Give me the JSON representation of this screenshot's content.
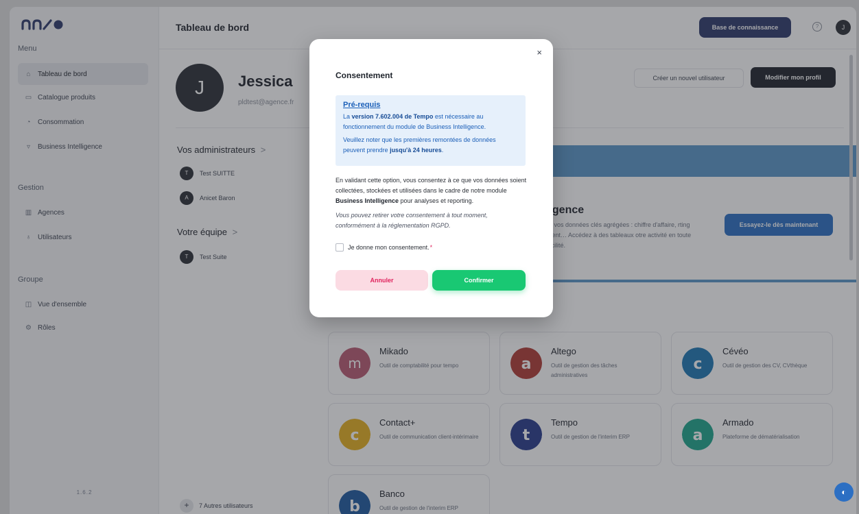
{
  "sidebar": {
    "logo": "enso",
    "sections": [
      {
        "title": "Menu",
        "items": [
          {
            "label": "Tableau de bord",
            "icon": "home-icon",
            "active": true
          },
          {
            "label": "Catalogue produits",
            "icon": "catalog-icon"
          },
          {
            "label": "Consommation",
            "icon": "chart-icon"
          },
          {
            "label": "Business Intelligence",
            "icon": "bi-icon"
          }
        ]
      },
      {
        "title": "Gestion",
        "items": [
          {
            "label": "Agences",
            "icon": "building-icon"
          },
          {
            "label": "Utilisateurs",
            "icon": "users-icon"
          }
        ]
      },
      {
        "title": "Groupe",
        "items": [
          {
            "label": "Vue d'ensemble",
            "icon": "overview-icon"
          },
          {
            "label": "Rôles",
            "icon": "roles-icon"
          }
        ]
      }
    ],
    "version": "1.6.2"
  },
  "header": {
    "title": "Tableau de bord",
    "knowledge_base_button": "Base de connaissance",
    "help_icon": "?",
    "avatar_initial": "J"
  },
  "profile": {
    "initial": "J",
    "name": "Jessica",
    "email": "pldtest@agence.fr",
    "create_user_button": "Créer un nouvel utilisateur",
    "edit_profile_button": "Modifier mon profil"
  },
  "administrators": {
    "title": "Vos administrateurs",
    "chevron": ">",
    "people": [
      {
        "initial": "T",
        "name": "Test SUITTE"
      },
      {
        "initial": "A",
        "name": "Anicet Baron"
      }
    ]
  },
  "team": {
    "title": "Votre équipe",
    "chevron": ">",
    "people": [
      {
        "initial": "T",
        "name": "Test Suite"
      }
    ],
    "more_users": "7 Autres utilisateurs"
  },
  "bi_banner": {
    "title": "ligence",
    "description": "eil vos données clés agrégées : chiffre d'affaire, rting client… Accédez à des tableaux otre activité en toute facilité.",
    "cta": "Essayez-le dès maintenant",
    "close": "✕"
  },
  "apps": [
    {
      "name": "Mikado",
      "description": "Outil de comptabilité pour tempo",
      "color": "#b85a72",
      "glyph": "m"
    },
    {
      "name": "Altego",
      "description": "Outil de gestion des tâches administratives",
      "color": "#b03b35",
      "glyph": "a"
    },
    {
      "name": "Cévéo",
      "description": "Outil de gestion des CV, CVthèque",
      "color": "#1e78b4",
      "glyph": "c"
    },
    {
      "name": "Contact+",
      "description": "Outil de communication client-intérimaire",
      "color": "#e6b020",
      "glyph": "c"
    },
    {
      "name": "Tempo",
      "description": "Outil de gestion de l'interim ERP",
      "color": "#283c8c",
      "glyph": "t"
    },
    {
      "name": "Armado",
      "description": "Plateforme de dématérialisation",
      "color": "#1ea58c",
      "glyph": "a"
    },
    {
      "name": "Banco",
      "description": "Outil de gestion de l'interim ERP",
      "color": "#1e5aa0",
      "glyph": "b"
    }
  ],
  "modal": {
    "title": "Consentement",
    "close": "×",
    "prereq_title": "Pré-requis",
    "prereq_p1_before": "La ",
    "prereq_p1_bold": "version 7.602.004 de Tempo",
    "prereq_p1_after": " est nécessaire au fonctionnement du module de Business Intelligence.",
    "prereq_p2_before": "Veuillez noter que les premières remontées de données peuvent prendre ",
    "prereq_p2_bold": "jusqu'à 24 heures",
    "prereq_p2_after": ".",
    "consent_text_before": "En validant cette option, vous consentez à ce que vos données soient collectées, stockées et utilisées dans le cadre de notre module ",
    "consent_text_bold": "Business Intelligence",
    "consent_text_after": " pour analyses et reporting.",
    "gdpr_text": "Vous pouvez retirer votre consentement à tout moment, conformément à la réglementation RGPD.",
    "checkbox_label": "Je donne mon consentement.",
    "required_mark": "*",
    "cancel_button": "Annuler",
    "confirm_button": "Confirmer"
  },
  "colors": {
    "primary_dark": "#2e3a6b",
    "confirm_green": "#19c873",
    "cancel_pink": "#fbdbe3",
    "link_blue": "#1b5fb8"
  }
}
